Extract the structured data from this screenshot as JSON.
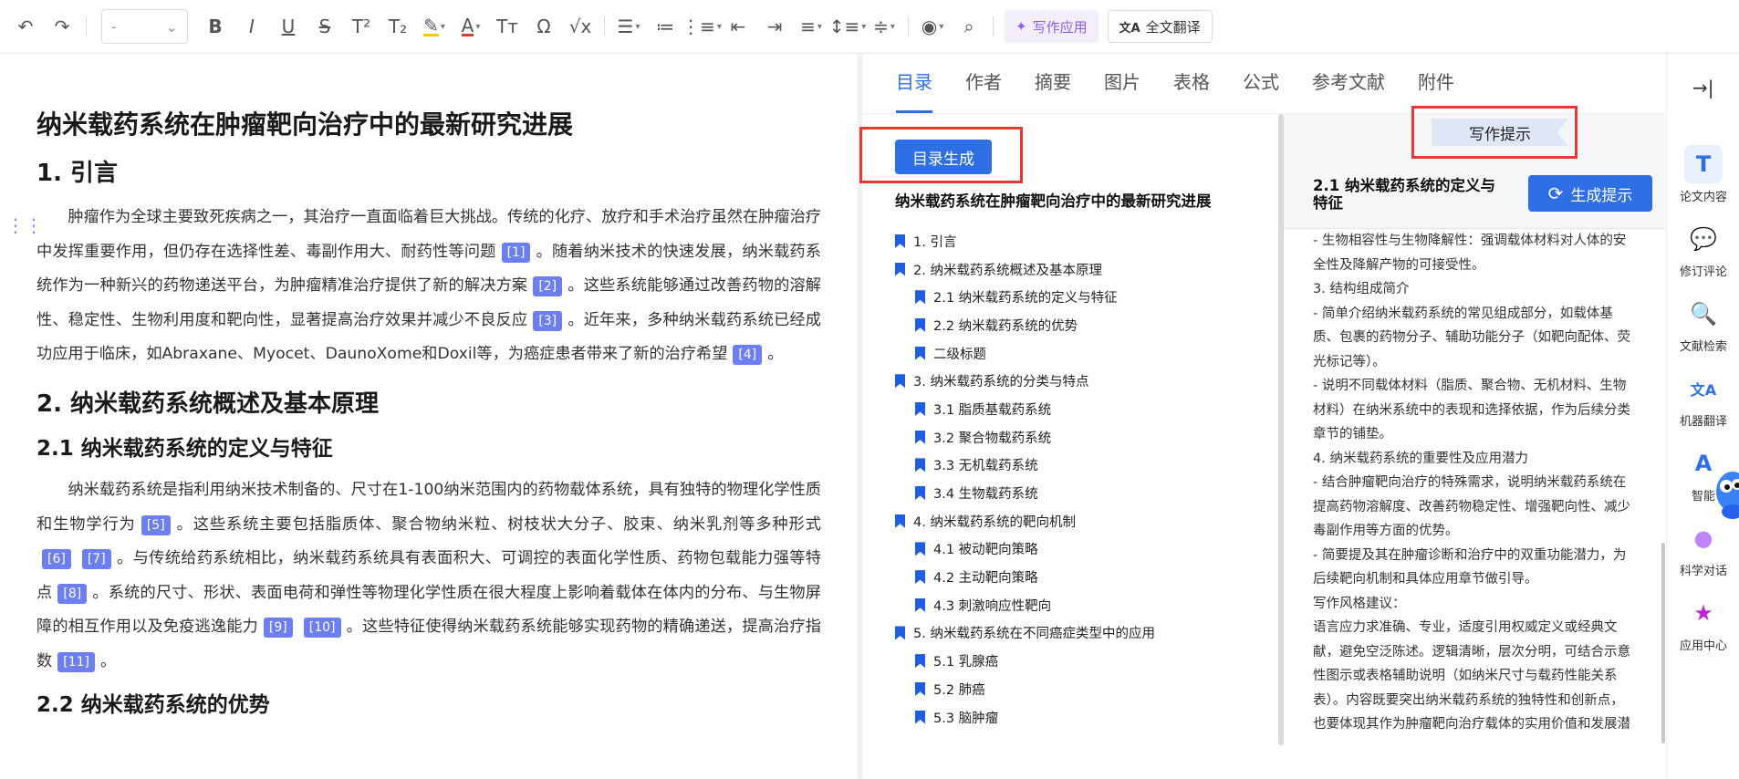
{
  "toolbar": {
    "font_value": "-",
    "ai_write_label": "写作应用",
    "translate_label": "全文翻译"
  },
  "document": {
    "title": "纳米载药系统在肿瘤靶向治疗中的最新研究进展",
    "sec1_heading": "1. 引言",
    "sec1_p1": [
      "肿瘤作为全球主要致死疾病之一，其治疗一直面临着巨大挑战。传统的化疗、放疗和手术治疗虽然在肿瘤治疗中发挥重要作用，但仍存在选择性差、毒副作用大、耐药性等问题",
      "[1]",
      "。随着纳米技术的快速发展，纳米载药系统作为一种新兴的药物递送平台，为肿瘤精准治疗提供了新的解决方案",
      "[2]",
      "。这些系统能够通过改善药物的溶解性、稳定性、生物利用度和靶向性，显著提高治疗效果并减少不良反应",
      "[3]",
      "。近年来，多种纳米载药系统已经成功应用于临床，如Abraxane、Myocet、DaunoXome和Doxil等，为癌症患者带来了新的治疗希望",
      "[4]",
      "。"
    ],
    "sec2_heading": "2. 纳米载药系统概述及基本原理",
    "sec21_heading": "2.1 纳米载药系统的定义与特征",
    "sec21_p1": [
      "纳米载药系统是指利用纳米技术制备的、尺寸在1-100纳米范围内的药物载体系统，具有独特的物理化学性质和生物学行为",
      "[5]",
      "。这些系统主要包括脂质体、聚合物纳米粒、树枝状大分子、胶束、纳米乳剂等多种形式",
      "[6]",
      "[7]",
      "。与传统给药系统相比，纳米载药系统具有表面积大、可调控的表面化学性质、药物包载能力强等特点",
      "[8]",
      "。系统的尺寸、形状、表面电荷和弹性等物理化学性质在很大程度上影响着载体在体内的分布、与生物屏障的相互作用以及免疫逃逸能力",
      "[9]",
      "[10]",
      "。这些特征使得纳米载药系统能够实现药物的精确递送，提高治疗指数",
      "[11]",
      "。"
    ],
    "sec22_heading": "2.2 纳米载药系统的优势"
  },
  "panel": {
    "tabs": [
      "目录",
      "作者",
      "摘要",
      "图片",
      "表格",
      "公式",
      "参考文献",
      "附件"
    ],
    "toc_button": "目录生成",
    "toc_title": "纳米载药系统在肿瘤靶向治疗中的最新研究进展",
    "toc_items": [
      "1. 引言",
      "2. 纳米载药系统概述及基本原理",
      "2.1 纳米载药系统的定义与特征",
      "2.2 纳米载药系统的优势",
      "二级标题",
      "3. 纳米载药系统的分类与特点",
      "3.1 脂质基载药系统",
      "3.2 聚合物载药系统",
      "3.3 无机载药系统",
      "3.4 生物载药系统",
      "4. 纳米载药系统的靶向机制",
      "4.1 被动靶向策略",
      "4.2 主动靶向策略",
      "4.3 刺激响应性靶向",
      "5. 纳米载药系统在不同癌症类型中的应用",
      "5.1 乳腺癌",
      "5.2 肺癌",
      "5.3 脑肿瘤"
    ],
    "hint_tag": "写作提示",
    "hint_heading": "2.1  纳米载药系统的定义与特征",
    "gen_hint_button": "生成提示",
    "hint_lines": [
      "- 生物相容性与生物降解性：强调载体材料对人体的安",
      "全性及降解产物的可接受性。",
      "3.  结构组成简介",
      "- 简单介绍纳米载药系统的常见组成部分，如载体基",
      "质、包裹的药物分子、辅助功能分子（如靶向配体、荧",
      "光标记等）。",
      "- 说明不同载体材料（脂质、聚合物、无机材料、生物",
      "材料）在纳米系统中的表现和选择依据，作为后续分类",
      "章节的铺垫。",
      "4.  纳米载药系统的重要性及应用潜力",
      "- 结合肿瘤靶向治疗的特殊需求，说明纳米载药系统在",
      "提高药物溶解度、改善药物稳定性、增强靶向性、减少",
      "毒副作用等方面的优势。",
      "- 简要提及其在肿瘤诊断和治疗中的双重功能潜力，为",
      "后续靶向机制和具体应用章节做引导。",
      "写作风格建议：",
      "语言应力求准确、专业，适度引用权威定义或经典文",
      "献，避免空泛陈述。逻辑清晰，层次分明，可结合示意",
      "性图示或表格辅助说明（如纳米尺寸与载药性能关系",
      "表）。内容既要突出纳米载药系统的独特性和创新点，",
      "也要体现其作为肿瘤靶向治疗载体的实用价值和发展潜"
    ]
  },
  "sidebar": {
    "items": [
      "论文内容",
      "修订评论",
      "文献检索",
      "机器翻译",
      "智能",
      "科学对话",
      "应用中心"
    ]
  },
  "colors": {
    "accent": "#2f6fe6",
    "citation": "#6d7ff0",
    "highlight_frame": "#e53935",
    "ai_purple": "#8b5cf6"
  }
}
